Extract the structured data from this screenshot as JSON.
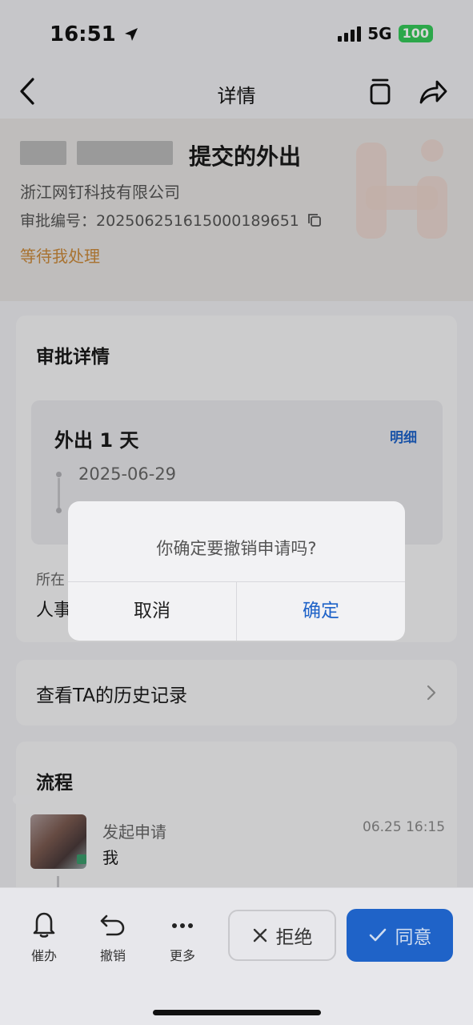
{
  "status_bar": {
    "time": "16:51",
    "network": "5G",
    "battery": "100"
  },
  "nav": {
    "title": "详情"
  },
  "header": {
    "title": "提交的外出",
    "company": "浙江网钉科技有限公司",
    "approval_no_label": "审批编号：",
    "approval_no": "202506251615000189651",
    "status": "等待我处理"
  },
  "details": {
    "title": "审批详情",
    "leave": {
      "title": "外出 1 天",
      "detail_link": "明细",
      "date": "2025-06-29"
    },
    "dept_label": "所在",
    "dept_value": "人事"
  },
  "history": {
    "label": "查看TA的历史记录"
  },
  "flow": {
    "title": "流程",
    "step": {
      "action": "发起申请",
      "name": "我",
      "time": "06.25 16:15"
    }
  },
  "dialog": {
    "message": "你确定要撤销申请吗?",
    "cancel": "取消",
    "confirm": "确定"
  },
  "bottom_bar": {
    "urge": "催办",
    "revoke": "撤销",
    "more": "更多",
    "reject": "拒绝",
    "agree": "同意"
  },
  "colors": {
    "accent": "#1f63c8",
    "pending": "#c9883a"
  }
}
